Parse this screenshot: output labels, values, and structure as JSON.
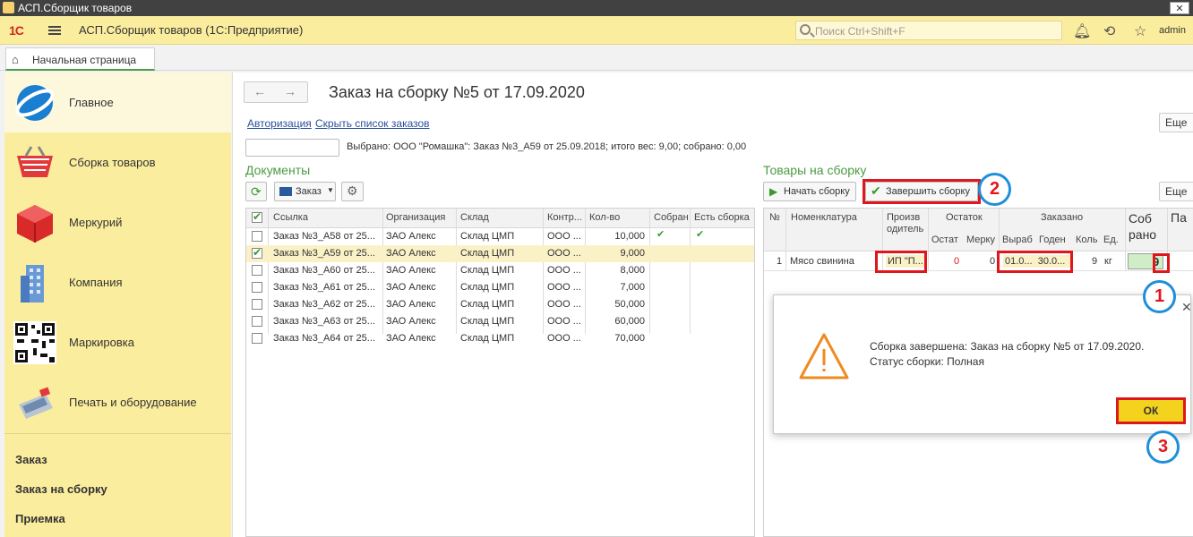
{
  "window": {
    "title": "АСП.Сборщик товаров",
    "close": "✕"
  },
  "topbar": {
    "logo": "1С",
    "title": "АСП.Сборщик товаров  (1С:Предприятие)",
    "search_placeholder": "Поиск Ctrl+Shift+F",
    "user": "admin"
  },
  "tabs": [
    {
      "label": "Начальная страница"
    }
  ],
  "sidebar": {
    "items": [
      {
        "label": "Главное",
        "icon": "globe-icon"
      },
      {
        "label": "Сборка товаров",
        "icon": "basket-icon"
      },
      {
        "label": "Меркурий",
        "icon": "cube-icon"
      },
      {
        "label": "Компания",
        "icon": "building-icon"
      },
      {
        "label": "Маркировка",
        "icon": "qr-code-icon"
      },
      {
        "label": "Печать и оборудование",
        "icon": "terminal-icon"
      }
    ],
    "links": [
      "Заказ",
      "Заказ на сборку",
      "Приемка"
    ]
  },
  "page": {
    "title": "Заказ на сборку №5 от 17.09.2020",
    "more": "Еще",
    "link_auth": "Авторизация",
    "link_hide": "Скрыть список заказов",
    "selected_text": "Выбрано: ООО \"Ромашка\": Заказ №3_А59 от 25.09.2018; итого вес: 9,00; собрано: 0,00"
  },
  "documents": {
    "title": "Документы",
    "order_btn": "Заказ",
    "columns": [
      "Ссылка",
      "Организация",
      "Склад",
      "Контр...",
      "Кол-во",
      "Собран",
      "Есть сборка"
    ],
    "rows": [
      {
        "checked": false,
        "ref": "Заказ №3_А58 от 25...",
        "org": "ЗАО Алекс",
        "stock": "Склад ЦМП",
        "contr": "ООО ...",
        "qty": "10,000",
        "collected": "✔",
        "has": "✔"
      },
      {
        "checked": true,
        "ref": "Заказ №3_А59 от 25...",
        "org": "ЗАО Алекс",
        "stock": "Склад ЦМП",
        "contr": "ООО ...",
        "qty": "9,000",
        "collected": "",
        "has": ""
      },
      {
        "checked": false,
        "ref": "Заказ №3_А60 от 25...",
        "org": "ЗАО Алекс",
        "stock": "Склад ЦМП",
        "contr": "ООО ...",
        "qty": "8,000",
        "collected": "",
        "has": ""
      },
      {
        "checked": false,
        "ref": "Заказ №3_А61 от 25...",
        "org": "ЗАО Алекс",
        "stock": "Склад ЦМП",
        "contr": "ООО ...",
        "qty": "7,000",
        "collected": "",
        "has": ""
      },
      {
        "checked": false,
        "ref": "Заказ №3_А62 от 25...",
        "org": "ЗАО Алекс",
        "stock": "Склад ЦМП",
        "contr": "ООО ...",
        "qty": "50,000",
        "collected": "",
        "has": ""
      },
      {
        "checked": false,
        "ref": "Заказ №3_А63 от 25...",
        "org": "ЗАО Алекс",
        "stock": "Склад ЦМП",
        "contr": "ООО ...",
        "qty": "60,000",
        "collected": "",
        "has": ""
      },
      {
        "checked": false,
        "ref": "Заказ №3_А64 от 25...",
        "org": "ЗАО Алекс",
        "stock": "Склад ЦМП",
        "contr": "ООО ...",
        "qty": "70,000",
        "collected": "",
        "has": ""
      }
    ]
  },
  "goods": {
    "title": "Товары на сборку",
    "start_btn": "Начать сборку",
    "finish_btn": "Завершить сборку",
    "more": "Еще",
    "headers": {
      "num": "№",
      "nom": "Номенклатура",
      "producer": "Произв одитель",
      "rest": "Остаток",
      "rest_ost": "Остат",
      "rest_merk": "Мерку",
      "ordered": "Заказано",
      "ord_vyr": "Выраб",
      "ord_god": "Годен",
      "ord_kol": "Коль",
      "ord_ed": "Ед.",
      "sobrano": "Соб рано",
      "pa": "Па"
    },
    "row": {
      "num": "1",
      "nom": "Мясо свинина",
      "producer": "ИП \"П...",
      "ost": "0",
      "merk": "0",
      "vyr": "01.0...",
      "god": "30.0...",
      "kol": "9",
      "ed": "кг",
      "sobrano": "9"
    }
  },
  "dialog": {
    "line1": "Сборка завершена: Заказ на сборку №5 от 17.09.2020.",
    "line2": "Статус сборки: Полная",
    "ok": "ОК",
    "close": "✕"
  },
  "annotations": [
    "1",
    "2",
    "3"
  ],
  "colors": {
    "accent_green": "#4a9b42",
    "sidebar_yellow": "#fbed9e",
    "highlight_red": "#e0161d",
    "badge_blue": "#1e8fd9",
    "ok_yellow": "#f4d31f"
  }
}
